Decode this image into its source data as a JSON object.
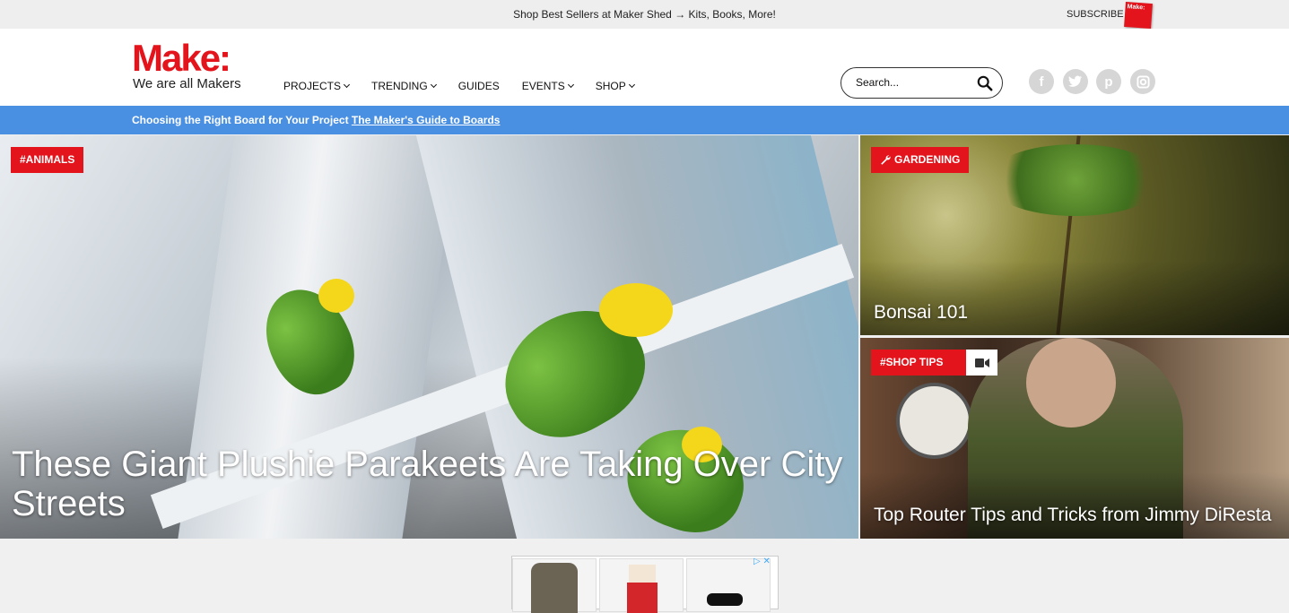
{
  "topbar": {
    "promo": "Shop Best Sellers at Maker Shed → Kits, Books, More!",
    "subscribe": "SUBSCRIBE",
    "magazine_label": "Make:"
  },
  "header": {
    "logo": "Make:",
    "tagline": "We are all Makers",
    "nav": [
      {
        "label": "PROJECTS",
        "dropdown": true
      },
      {
        "label": "TRENDING",
        "dropdown": true
      },
      {
        "label": "GUIDES",
        "dropdown": false
      },
      {
        "label": "EVENTS",
        "dropdown": true
      },
      {
        "label": "SHOP",
        "dropdown": true
      }
    ],
    "search_placeholder": "Search...",
    "social": [
      "facebook-icon",
      "twitter-icon",
      "pinterest-icon",
      "instagram-icon"
    ]
  },
  "banner": {
    "text": "Choosing the Right Board for Your Project",
    "link": "The Maker's Guide to Boards"
  },
  "tiles": {
    "hero": {
      "tag": "#ANIMALS",
      "title": "These Giant Plushie Parakeets Are Taking Over City Streets"
    },
    "bonsai": {
      "tag": "GARDENING",
      "title": "Bonsai 101"
    },
    "router": {
      "tag": "#SHOP TIPS",
      "title": "Top Router Tips and Tricks from Jimmy DiResta"
    }
  },
  "colors": {
    "brand": "#e3141b",
    "banner": "#4a90e2"
  }
}
